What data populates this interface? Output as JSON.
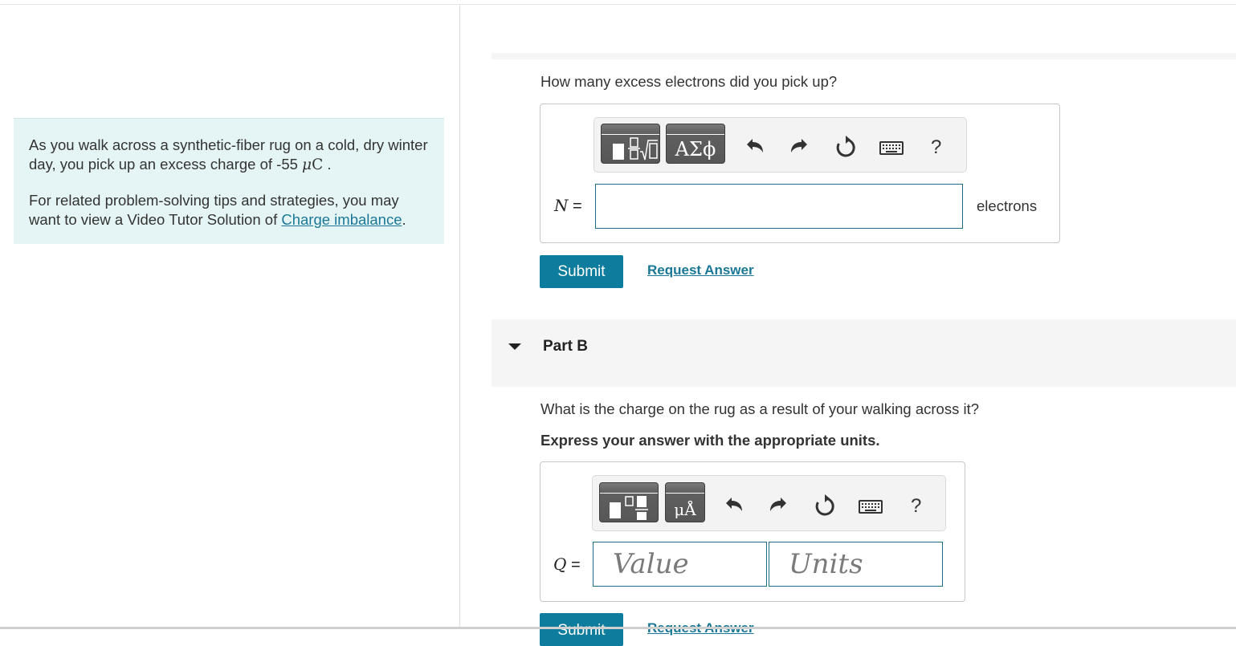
{
  "problem": {
    "intro_prefix": "As you walk across a synthetic-fiber rug on a cold, dry winter day, you pick up an excess charge of -55 ",
    "intro_unit_mu": "μ",
    "intro_unit_c": "C",
    "intro_suffix": " .",
    "tip_prefix": "For related problem-solving tips and strategies, you may want to view a Video Tutor Solution of ",
    "tip_link": "Charge imbalance",
    "tip_suffix": "."
  },
  "part_a": {
    "question": "How many excess electrons did you pick up?",
    "toolbar": {
      "templates_icon": "fraction-root-template-icon",
      "greek_label": "ΑΣϕ",
      "undo_icon": "undo-icon",
      "redo_icon": "redo-icon",
      "reset_icon": "reset-icon",
      "keyboard_icon": "keyboard-icon",
      "help_label": "?"
    },
    "variable": "N",
    "equals": " =",
    "input_value": "",
    "unit": "electrons",
    "submit_label": "Submit",
    "request_label": "Request Answer"
  },
  "part_b": {
    "title": "Part B",
    "question": "What is the charge on the rug as a result of your walking across it?",
    "instruction": "Express your answer with the appropriate units.",
    "toolbar": {
      "templates_icon": "value-units-template-icon",
      "units_label": "μÅ",
      "undo_icon": "undo-icon",
      "redo_icon": "redo-icon",
      "reset_icon": "reset-icon",
      "keyboard_icon": "keyboard-icon",
      "help_label": "?"
    },
    "variable": "Q",
    "equals": " =",
    "value_placeholder": "Value",
    "units_placeholder": "Units",
    "submit_label": "Submit",
    "request_label": "Request Answer"
  },
  "colors": {
    "accent": "#0e7c9c",
    "link": "#1a7896",
    "info_bg": "#e5f5f5",
    "input_border": "#1e6b86"
  }
}
